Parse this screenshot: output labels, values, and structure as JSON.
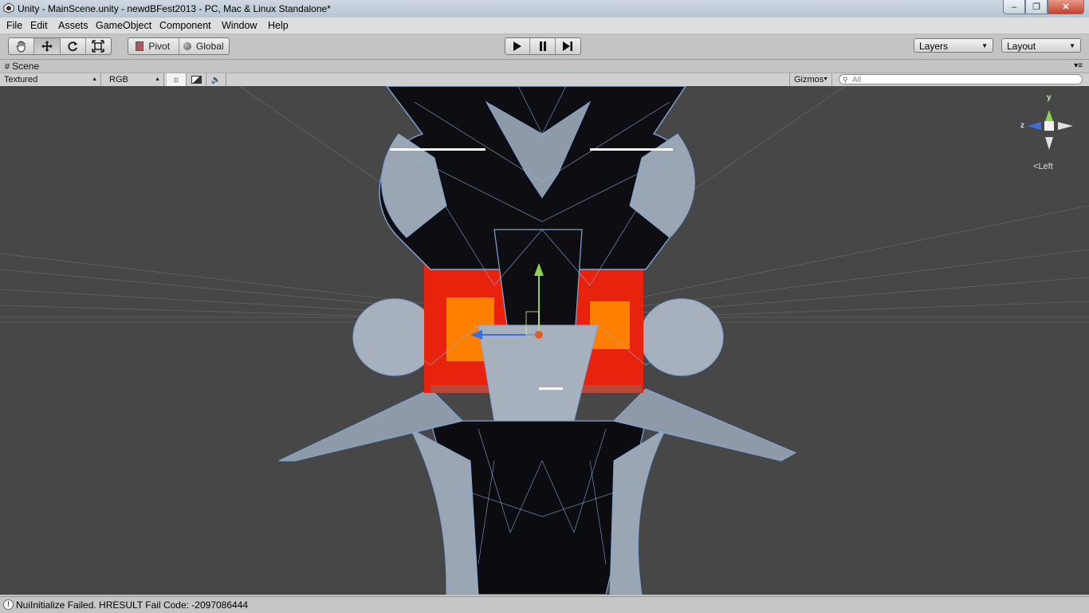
{
  "window": {
    "title": "Unity - MainScene.unity - newdBFest2013 - PC, Mac & Linux Standalone*",
    "minimize": "–",
    "maximize": "❐",
    "close": "✕"
  },
  "menu": [
    "File",
    "Edit",
    "Assets",
    "GameObject",
    "Component",
    "Window",
    "Help"
  ],
  "toolbar": {
    "transform_tools": [
      "hand-tool",
      "move-tool",
      "rotate-tool",
      "scale-tool"
    ],
    "active_tool": "move-tool",
    "pivot_label": "Pivot",
    "global_label": "Global",
    "layers_label": "Layers",
    "layout_label": "Layout"
  },
  "scene_panel": {
    "tab_label": "Scene",
    "render_mode": "Textured",
    "color_mode": "RGB",
    "gizmos_label": "Gizmos",
    "search_placeholder": "All"
  },
  "scene_gizmo": {
    "y_label": "y",
    "z_label": "z",
    "view_label": "Left"
  },
  "status": {
    "message": "NuiInitialize Failed. HRESULT Fail Code: -2097086444"
  },
  "colors": {
    "viewport_bg": "#474747",
    "wireframe": "#7fa6d9",
    "mesh": "#9aa6b3",
    "red_panel": "#e8220c",
    "orange_panel": "#ff7f00",
    "gizmo_y": "#8fd14f",
    "gizmo_z": "#3a6fe0"
  }
}
